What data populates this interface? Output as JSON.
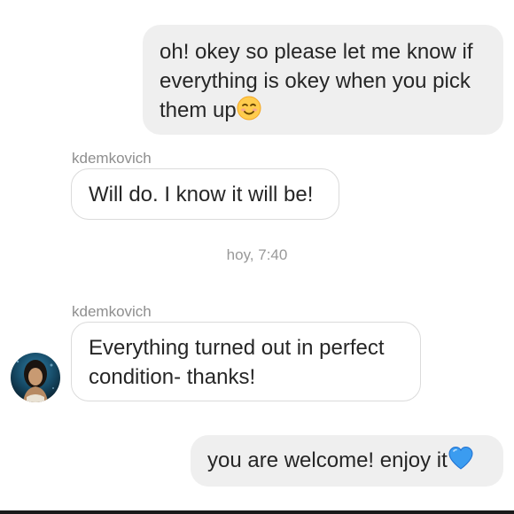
{
  "messages": [
    {
      "direction": "outgoing",
      "text": "oh! okey so please let me know if everything is okey when you pick them up",
      "emoji": "smiling-face-icon"
    },
    {
      "direction": "incoming",
      "sender": "kdemkovich",
      "text": "Will do. I know it will be!"
    },
    {
      "direction": "incoming",
      "sender": "kdemkovich",
      "text": "Everything turned out in perfect condition- thanks!"
    },
    {
      "direction": "outgoing",
      "text": "you are welcome! enjoy it",
      "emoji": "blue-heart-icon"
    }
  ],
  "timestamp": "hoy, 7:40",
  "colors": {
    "outgoing_bubble": "#efefef",
    "incoming_border": "#dbdbdb",
    "text": "#262626",
    "meta_text": "#8e8e8e",
    "heart": "#3b9cf0"
  }
}
